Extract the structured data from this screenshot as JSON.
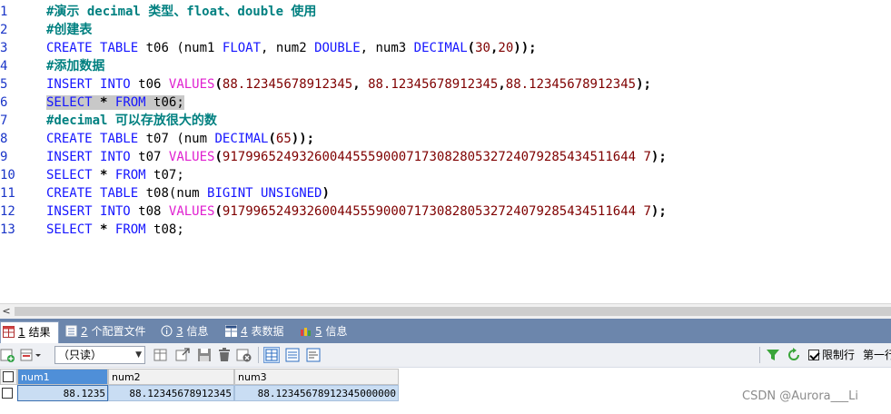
{
  "editor": {
    "lines": [
      {
        "no": "1",
        "tokens": [
          {
            "t": "#演示 decimal 类型、float、double 使用",
            "c": "cm"
          }
        ]
      },
      {
        "no": "2",
        "tokens": [
          {
            "t": "#创建表",
            "c": "cm"
          }
        ]
      },
      {
        "no": "3",
        "tokens": [
          {
            "t": "CREATE",
            "c": "kw"
          },
          {
            "t": " ",
            "c": "id"
          },
          {
            "t": "TABLE",
            "c": "kw"
          },
          {
            "t": " t06 (num1 ",
            "c": "id"
          },
          {
            "t": "FLOAT",
            "c": "ty"
          },
          {
            "t": ", num2 ",
            "c": "id"
          },
          {
            "t": "DOUBLE",
            "c": "ty"
          },
          {
            "t": ", num3 ",
            "c": "id"
          },
          {
            "t": "DECIMAL",
            "c": "ty"
          },
          {
            "t": "(",
            "c": "op"
          },
          {
            "t": "30",
            "c": "num"
          },
          {
            "t": ",",
            "c": "op"
          },
          {
            "t": "20",
            "c": "num"
          },
          {
            "t": "));",
            "c": "op"
          }
        ]
      },
      {
        "no": "4",
        "tokens": [
          {
            "t": "#添加数据",
            "c": "cm"
          }
        ]
      },
      {
        "no": "5",
        "tokens": [
          {
            "t": "INSERT",
            "c": "kw"
          },
          {
            "t": " ",
            "c": "id"
          },
          {
            "t": "INTO",
            "c": "kw"
          },
          {
            "t": " t06 ",
            "c": "id"
          },
          {
            "t": "VALUES",
            "c": "fn"
          },
          {
            "t": "(",
            "c": "op"
          },
          {
            "t": "88.12345678912345",
            "c": "num"
          },
          {
            "t": ", ",
            "c": "op"
          },
          {
            "t": "88.12345678912345",
            "c": "num"
          },
          {
            "t": ",",
            "c": "op"
          },
          {
            "t": "88.12345678912345",
            "c": "num"
          },
          {
            "t": ");",
            "c": "op"
          }
        ]
      },
      {
        "no": "6",
        "selected": true,
        "tokens": [
          {
            "t": "SELECT",
            "c": "kw"
          },
          {
            "t": " ",
            "c": "id"
          },
          {
            "t": "*",
            "c": "op"
          },
          {
            "t": " ",
            "c": "id"
          },
          {
            "t": "FROM",
            "c": "kw"
          },
          {
            "t": " t06;",
            "c": "id"
          }
        ]
      },
      {
        "no": "7",
        "tokens": [
          {
            "t": "#decimal 可以存放很大的数",
            "c": "cm"
          }
        ]
      },
      {
        "no": "8",
        "tokens": [
          {
            "t": "CREATE",
            "c": "kw"
          },
          {
            "t": " ",
            "c": "id"
          },
          {
            "t": "TABLE",
            "c": "kw"
          },
          {
            "t": " t07 (num ",
            "c": "id"
          },
          {
            "t": "DECIMAL",
            "c": "ty"
          },
          {
            "t": "(",
            "c": "op"
          },
          {
            "t": "65",
            "c": "num"
          },
          {
            "t": "));",
            "c": "op"
          }
        ]
      },
      {
        "no": "9",
        "tokens": [
          {
            "t": "INSERT",
            "c": "kw"
          },
          {
            "t": " ",
            "c": "id"
          },
          {
            "t": "INTO",
            "c": "kw"
          },
          {
            "t": " t07 ",
            "c": "id"
          },
          {
            "t": "VALUES",
            "c": "fn"
          },
          {
            "t": "(",
            "c": "op"
          },
          {
            "t": "917996524932600445559000717308280532724079285434511644 7",
            "c": "num"
          },
          {
            "t": ");",
            "c": "op"
          }
        ]
      },
      {
        "no": "10",
        "tokens": [
          {
            "t": "SELECT",
            "c": "kw"
          },
          {
            "t": " ",
            "c": "id"
          },
          {
            "t": "*",
            "c": "op"
          },
          {
            "t": " ",
            "c": "id"
          },
          {
            "t": "FROM",
            "c": "kw"
          },
          {
            "t": " t07;",
            "c": "id"
          }
        ]
      },
      {
        "no": "11",
        "tokens": [
          {
            "t": "CREATE",
            "c": "kw"
          },
          {
            "t": " ",
            "c": "id"
          },
          {
            "t": "TABLE",
            "c": "kw"
          },
          {
            "t": " t08(num ",
            "c": "id"
          },
          {
            "t": "BIGINT",
            "c": "ty"
          },
          {
            "t": " ",
            "c": "id"
          },
          {
            "t": "UNSIGNED",
            "c": "ty"
          },
          {
            "t": ")",
            "c": "op"
          }
        ]
      },
      {
        "no": "12",
        "tokens": [
          {
            "t": "INSERT",
            "c": "kw"
          },
          {
            "t": " ",
            "c": "id"
          },
          {
            "t": "INTO",
            "c": "kw"
          },
          {
            "t": " t08 ",
            "c": "id"
          },
          {
            "t": "VALUES",
            "c": "fn"
          },
          {
            "t": "(",
            "c": "op"
          },
          {
            "t": "917996524932600445559000717308280532724079285434511644 7",
            "c": "num"
          },
          {
            "t": ");",
            "c": "op"
          }
        ]
      },
      {
        "no": "13",
        "tokens": [
          {
            "t": "SELECT",
            "c": "kw"
          },
          {
            "t": " ",
            "c": "id"
          },
          {
            "t": "*",
            "c": "op"
          },
          {
            "t": " ",
            "c": "id"
          },
          {
            "t": "FROM",
            "c": "kw"
          },
          {
            "t": " t08;",
            "c": "id"
          }
        ]
      }
    ]
  },
  "scrollbar": {
    "left_arrow": "<"
  },
  "tabs": [
    {
      "num": "1",
      "label": "结果",
      "icon": "grid-result-icon",
      "active": true
    },
    {
      "num": "2",
      "label": "个配置文件",
      "icon": "profile-icon",
      "active": false
    },
    {
      "num": "3",
      "label": "信息",
      "icon": "info-icon",
      "active": false
    },
    {
      "num": "4",
      "label": "表数据",
      "icon": "table-data-icon",
      "active": false
    },
    {
      "num": "5",
      "label": "信息",
      "icon": "info-multi-icon",
      "active": false
    }
  ],
  "toolbar": {
    "readonly_option": "（只读）",
    "limit_rows_label": "限制行",
    "first_row_label": "第一行",
    "limit_rows_checked": true
  },
  "results": {
    "columns": [
      "num1",
      "num2",
      "num3"
    ],
    "rows": [
      [
        "88.1235",
        "88.12345678912345",
        "88.12345678912345000000"
      ]
    ]
  },
  "watermark": "CSDN @Aurora___Li",
  "colors": {
    "keyword": "#1515ff",
    "function": "#e01fd0",
    "number": "#7f0000",
    "comment": "#008080",
    "line_number": "#1a35c8",
    "tab_bar": "#6c86ac",
    "grid_cell": "#c9ddf3",
    "grid_header_selected": "#4f8fd8"
  }
}
